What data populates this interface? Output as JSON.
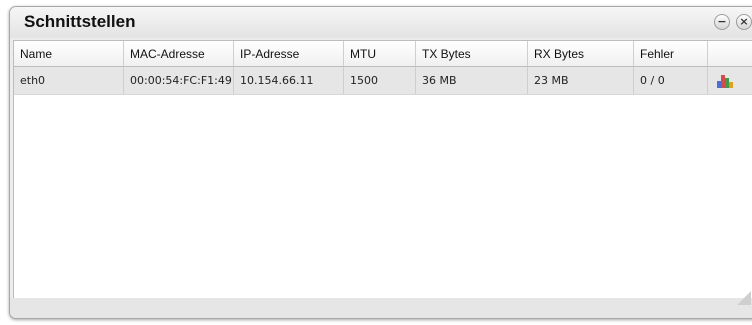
{
  "window": {
    "title": "Schnittstellen",
    "minimize_label": "−",
    "close_label": "×"
  },
  "table": {
    "headers": {
      "name": "Name",
      "mac": "MAC-Adresse",
      "ip": "IP-Adresse",
      "mtu": "MTU",
      "tx": "TX Bytes",
      "rx": "RX Bytes",
      "errors": "Fehler"
    },
    "rows": [
      {
        "name": "eth0",
        "mac": "00:00:54:FC:F1:49",
        "ip": "10.154.66.11",
        "mtu": "1500",
        "tx": "36 MB",
        "rx": "23 MB",
        "errors": "0 / 0",
        "action_icon": "bar-chart-icon"
      }
    ]
  },
  "colors": {
    "chart_icon_bars": [
      "#4a6fd6",
      "#d44b4b",
      "#3f9b4a",
      "#e0a020"
    ]
  }
}
